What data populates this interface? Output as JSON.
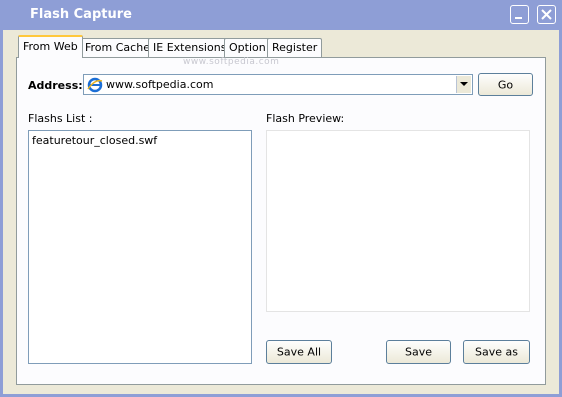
{
  "window": {
    "title": "Flash Capture"
  },
  "tabs": [
    {
      "label": "From Web",
      "active": true
    },
    {
      "label": "From Cache",
      "active": false
    },
    {
      "label": "IE Extensions",
      "active": false
    },
    {
      "label": "Option",
      "active": false
    },
    {
      "label": "Register",
      "active": false
    }
  ],
  "watermark": "www.softpedia.com",
  "address": {
    "label": "Address:",
    "value": "www.softpedia.com",
    "icon": "ie-icon"
  },
  "go_label": "Go",
  "flashs_list": {
    "label": "Flashs List :",
    "items": [
      "featuretour_closed.swf"
    ]
  },
  "preview": {
    "label": "Flash Preview:"
  },
  "buttons": {
    "save_all": "Save All",
    "save": "Save",
    "save_as": "Save as"
  },
  "colors": {
    "titlebar": "#8e9ed6",
    "window_bg": "#ece9d8",
    "active_tab_highlight": "#ffc83c"
  }
}
